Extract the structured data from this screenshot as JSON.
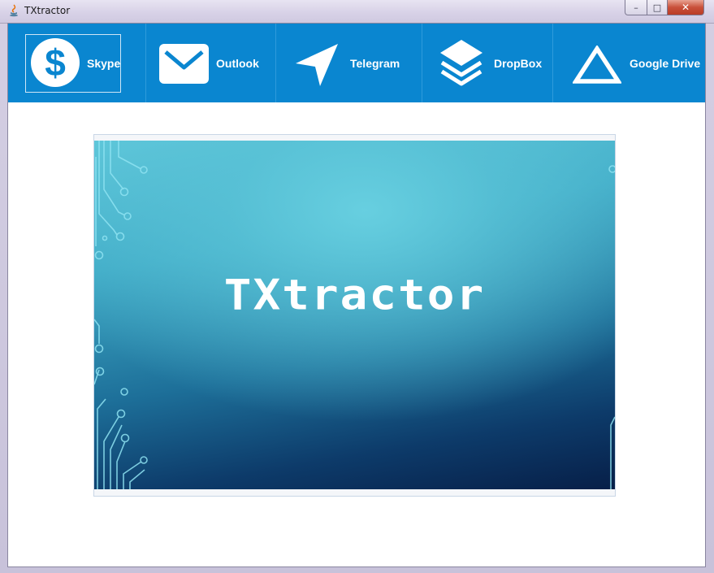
{
  "window": {
    "title": "TXtractor",
    "minimize_glyph": "–",
    "maximize_glyph": "□",
    "close_glyph": "✕"
  },
  "toolbar": {
    "accent_color": "#0a86d0",
    "items": [
      {
        "label": "Skype",
        "icon": "dollar-circle-icon"
      },
      {
        "label": "Outlook",
        "icon": "envelope-icon"
      },
      {
        "label": "Telegram",
        "icon": "paper-plane-icon"
      },
      {
        "label": "DropBox",
        "icon": "layers-icon"
      },
      {
        "label": "Google Drive",
        "icon": "triangle-icon"
      }
    ]
  },
  "splash": {
    "title": "TXtractor"
  }
}
